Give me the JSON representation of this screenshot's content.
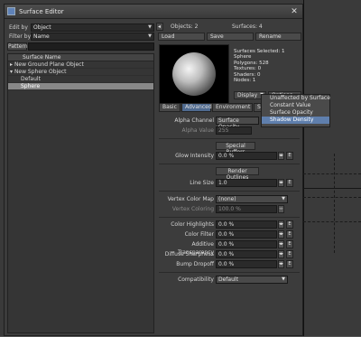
{
  "window": {
    "title": "Surface Editor"
  },
  "left": {
    "edit_by_label": "Edit by",
    "edit_by_value": "Object",
    "filter_by_label": "Filter by",
    "filter_by_value": "Name",
    "pattern_label": "Pattern",
    "pattern_value": "",
    "list_header": "Surface Name",
    "tree": [
      {
        "label": "New Ground Plane Object",
        "type": "object",
        "selected": false
      },
      {
        "label": "New Sphere Object",
        "type": "object",
        "selected": false
      },
      {
        "label": "Default",
        "type": "surface",
        "selected": false
      },
      {
        "label": "Sphere",
        "type": "surface",
        "selected": true
      }
    ]
  },
  "right": {
    "objects": "Objects: 2",
    "surfaces": "Surfaces: 4",
    "load": "Load",
    "save": "Save",
    "rename": "Rename",
    "info": [
      "Surfaces Selected: 1",
      "Sphere",
      "Polygons: 528",
      "Textures: 0",
      "Shaders: 0",
      "Nodes: 1"
    ],
    "display_label": "Display",
    "options_label": "Options",
    "tabs": [
      "Basic",
      "Advanced",
      "Environment",
      "Sh"
    ],
    "alpha_channel_label": "Alpha Channel",
    "alpha_channel_value": "Surface Opacity",
    "alpha_value_label": "Alpha Value",
    "alpha_value_value": "255",
    "special_buffers": "Special Buffers",
    "glow_label": "Glow Intensity",
    "glow_value": "0.0 %",
    "render_outlines": "Render Outlines",
    "line_size_label": "Line Size",
    "line_size_value": "1.0",
    "vertex_color_map_label": "Vertex Color Map",
    "vertex_color_map_value": "(none)",
    "vertex_coloring_label": "Vertex Coloring",
    "vertex_coloring_value": "100.0 %",
    "color_highlights_label": "Color Highlights",
    "color_highlights_value": "0.0 %",
    "color_filter_label": "Color Filter",
    "color_filter_value": "0.0 %",
    "additive_transparency_label": "Additive Transparency",
    "additive_transparency_value": "0.0 %",
    "diffuse_sharpness_label": "Diffuse Sharpness",
    "diffuse_sharpness_value": "0.0 %",
    "bump_dropoff_label": "Bump Dropoff",
    "bump_dropoff_value": "0.0 %",
    "compatibility_label": "Compatibility",
    "compatibility_value": "Default",
    "e_label": "E",
    "slide_label": "◂▸"
  },
  "popup": {
    "items": [
      {
        "label": "Unaffected by Surface",
        "highlight": false
      },
      {
        "label": "Constant Value",
        "highlight": false
      },
      {
        "label": "Surface Opacity",
        "highlight": false
      },
      {
        "label": "Shadow Density",
        "highlight": true
      }
    ]
  },
  "colors": {
    "selection": "#888888",
    "menu_highlight": "#5f7fad",
    "active_tab": "#4f6a8f"
  }
}
